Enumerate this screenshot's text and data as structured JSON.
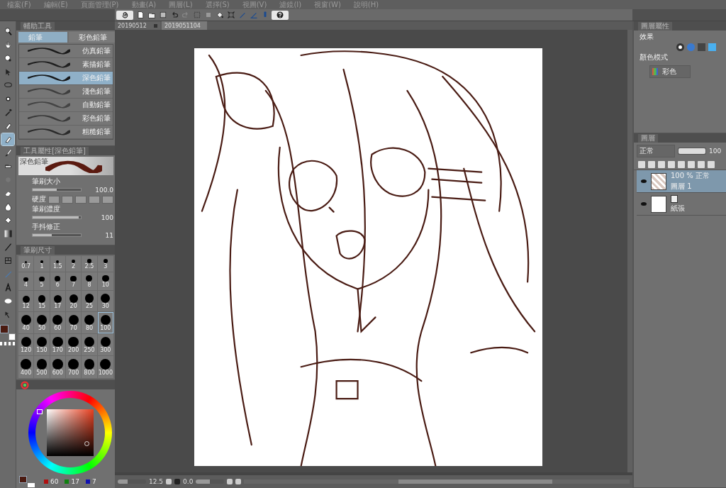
{
  "menu": [
    "檔案(F)",
    "編輯(E)",
    "頁面管理(P)",
    "動畫(A)",
    "圖層(L)",
    "選擇(S)",
    "視圖(V)",
    "濾鏡(I)",
    "視窗(W)",
    "說明(H)"
  ],
  "command_bar": [
    {
      "kind": "spiral"
    },
    {
      "kind": "new"
    },
    {
      "kind": "open"
    },
    {
      "kind": "save"
    },
    {
      "kind": "undo"
    },
    {
      "kind": "redo"
    },
    {
      "kind": "dots"
    },
    {
      "kind": "square"
    },
    {
      "kind": "bucket"
    },
    {
      "kind": "transform"
    },
    {
      "kind": "pen-a"
    },
    {
      "kind": "pen-b"
    },
    {
      "kind": "pen-c"
    },
    {
      "kind": "help"
    }
  ],
  "document_tabs": [
    {
      "label": "20190512",
      "selected": false
    },
    {
      "label": "2019051104",
      "selected": true
    }
  ],
  "tools": [
    {
      "kind": "zoom",
      "selected": false
    },
    {
      "kind": "hand",
      "selected": false
    },
    {
      "kind": "eyedropper",
      "selected": false
    },
    {
      "kind": "move",
      "selected": false
    },
    {
      "kind": "lasso",
      "selected": false
    },
    {
      "kind": "wand",
      "selected": false
    },
    {
      "kind": "pipette",
      "selected": false
    },
    {
      "kind": "pen",
      "selected": false
    },
    {
      "kind": "pencil",
      "selected": true
    },
    {
      "kind": "brush",
      "selected": false
    },
    {
      "kind": "airbrush",
      "selected": false
    },
    {
      "kind": "blend",
      "selected": false
    },
    {
      "kind": "eraser",
      "selected": false
    },
    {
      "kind": "drop",
      "selected": false
    },
    {
      "kind": "fill",
      "selected": false
    },
    {
      "kind": "gradient",
      "selected": false
    },
    {
      "kind": "line",
      "selected": false
    },
    {
      "kind": "frame",
      "selected": false
    },
    {
      "kind": "ruler",
      "selected": false
    },
    {
      "kind": "text",
      "selected": false
    },
    {
      "kind": "balloon",
      "selected": false
    },
    {
      "kind": "correct",
      "selected": false
    }
  ],
  "sub_tool": {
    "title": "輔助工具",
    "groups": [
      {
        "label": "鉛筆",
        "selected": true
      },
      {
        "label": "彩色鉛筆",
        "selected": false
      }
    ],
    "brushes": [
      {
        "name": "仿真鉛筆",
        "selected": false
      },
      {
        "name": "素描鉛筆",
        "selected": false
      },
      {
        "name": "深色鉛筆",
        "selected": true
      },
      {
        "name": "淺色鉛筆",
        "selected": false
      },
      {
        "name": "自動鉛筆",
        "selected": false
      },
      {
        "name": "彩色鉛筆",
        "selected": false
      },
      {
        "name": "粗糙鉛筆",
        "selected": false
      }
    ]
  },
  "tool_property": {
    "title": "工具屬性[深色鉛筆]",
    "preview_label": "深色鉛筆",
    "settings": [
      {
        "kind": "slider",
        "label": "筆刷大小",
        "value": "100.0",
        "level": 0.5
      },
      {
        "kind": "hardness",
        "label": "硬度"
      },
      {
        "kind": "slider",
        "label": "筆刷濃度",
        "value": "100",
        "level": 0.95
      },
      {
        "kind": "slider",
        "label": "手抖修正",
        "value": "11",
        "level": 0.4
      }
    ]
  },
  "brush_size": {
    "title": "筆刷尺寸",
    "sizes": [
      {
        "label": "0.7",
        "selected": false
      },
      {
        "label": "1",
        "selected": false
      },
      {
        "label": "1.5",
        "selected": false
      },
      {
        "label": "2",
        "selected": false
      },
      {
        "label": "2.5",
        "selected": false
      },
      {
        "label": "3",
        "selected": false
      },
      {
        "label": "4",
        "selected": false
      },
      {
        "label": "5",
        "selected": false
      },
      {
        "label": "6",
        "selected": false
      },
      {
        "label": "7",
        "selected": false
      },
      {
        "label": "8",
        "selected": false
      },
      {
        "label": "10",
        "selected": false
      },
      {
        "label": "12",
        "selected": false
      },
      {
        "label": "15",
        "selected": false
      },
      {
        "label": "17",
        "selected": false
      },
      {
        "label": "20",
        "selected": false
      },
      {
        "label": "25",
        "selected": false
      },
      {
        "label": "30",
        "selected": false
      },
      {
        "label": "40",
        "selected": false
      },
      {
        "label": "50",
        "selected": false
      },
      {
        "label": "60",
        "selected": false
      },
      {
        "label": "70",
        "selected": false
      },
      {
        "label": "80",
        "selected": false
      },
      {
        "label": "100",
        "selected": true
      },
      {
        "label": "120",
        "selected": false
      },
      {
        "label": "150",
        "selected": false
      },
      {
        "label": "170",
        "selected": false
      },
      {
        "label": "200",
        "selected": false
      },
      {
        "label": "250",
        "selected": false
      },
      {
        "label": "300",
        "selected": false
      },
      {
        "label": "400",
        "selected": false
      },
      {
        "label": "500",
        "selected": false
      },
      {
        "label": "600",
        "selected": false
      },
      {
        "label": "700",
        "selected": false
      },
      {
        "label": "800",
        "selected": false
      },
      {
        "label": "1000",
        "selected": false
      }
    ]
  },
  "color_wheel": {
    "rgb": [
      "60",
      "17",
      "7"
    ]
  },
  "layer_property": {
    "title": "圖層屬性",
    "effect_label": "效果",
    "color_mode_label": "顏色模式",
    "color_mode": "彩色"
  },
  "layers": {
    "title": "圖層",
    "blend_mode": "正常",
    "opacity_slider": {
      "level": 1
    },
    "opacity": "100",
    "items": [
      {
        "mode": "100 % 正常",
        "name": "圖層 1",
        "visible": true,
        "selected": true,
        "kind": "raster"
      },
      {
        "name": "紙張",
        "visible": true,
        "selected": false,
        "kind": "paper"
      }
    ]
  },
  "status_bar": {
    "zoom_slider": {
      "level": 0.35
    },
    "zoom": "12.5",
    "angle": "0.0",
    "rotate_slider": {
      "level": 0.5
    }
  }
}
